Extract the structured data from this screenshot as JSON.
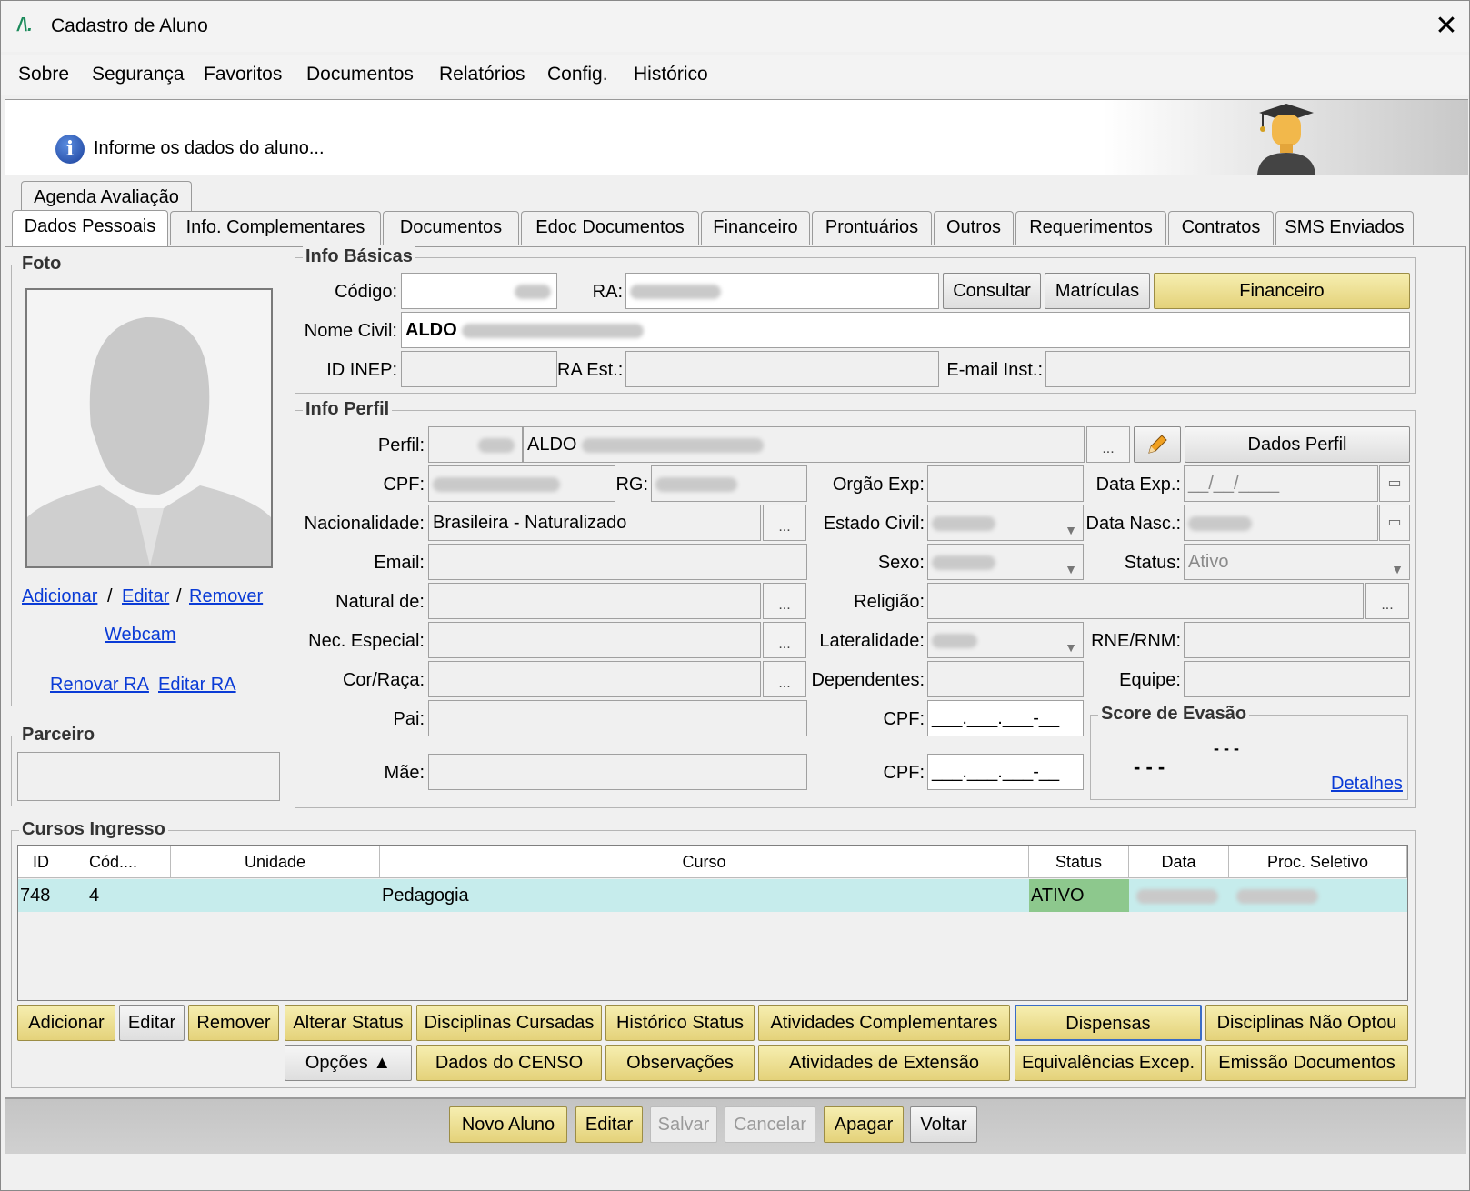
{
  "window": {
    "title": "Cadastro de Aluno",
    "logo": "/\\.",
    "close_icon": "✕"
  },
  "menu": [
    "Sobre",
    "Segurança",
    "Favoritos",
    "Documentos",
    "Relatórios",
    "Config.",
    "Histórico"
  ],
  "banner": {
    "text": "Informe os dados do aluno...",
    "info_glyph": "i"
  },
  "tabs_top": [
    "Agenda Avaliação"
  ],
  "tabs": [
    "Dados Pessoais",
    "Info. Complementares",
    "Documentos",
    "Edoc Documentos",
    "Financeiro",
    "Prontuários",
    "Outros",
    "Requerimentos",
    "Contratos",
    "SMS Enviados"
  ],
  "foto": {
    "title": "Foto",
    "add": "Adicionar",
    "sep": "/",
    "edit": "Editar",
    "remove": "Remover",
    "webcam": "Webcam",
    "renew_ra": "Renovar RA",
    "edit_ra": "Editar RA"
  },
  "parceiro": {
    "title": "Parceiro"
  },
  "info_basicas": {
    "title": "Info Básicas",
    "codigo_label": "Código:",
    "ra_label": "RA:",
    "consultar": "Consultar",
    "matriculas": "Matrículas",
    "financeiro": "Financeiro",
    "nome_label": "Nome Civil:",
    "nome_value": "ALDO",
    "inep_label": "ID INEP:",
    "ra_est_label": "RA Est.:",
    "email_inst_label": "E-mail Inst.:"
  },
  "info_perfil": {
    "title": "Info Perfil",
    "perfil_label": "Perfil:",
    "perfil_name": "ALDO",
    "dados_perfil": "Dados Perfil",
    "dots": "...",
    "cpf_label": "CPF:",
    "rg_label": "RG:",
    "orgao_label": "Orgão Exp:",
    "data_exp_label": "Data Exp.:",
    "data_exp_value": "__/__/____",
    "nacionalidade_label": "Nacionalidade:",
    "nacionalidade_value": "Brasileira - Naturalizado",
    "estado_civil_label": "Estado Civil:",
    "data_nasc_label": "Data Nasc.:",
    "email_label": "Email:",
    "sexo_label": "Sexo:",
    "status_label": "Status:",
    "status_value": "Ativo",
    "natural_label": "Natural de:",
    "religiao_label": "Religião:",
    "nec_label": "Nec. Especial:",
    "lateralidade_label": "Lateralidade:",
    "rne_label": "RNE/RNM:",
    "cor_label": "Cor/Raça:",
    "dependentes_label": "Dependentes:",
    "equipe_label": "Equipe:",
    "pai_label": "Pai:",
    "mae_label": "Mãe:",
    "cpf_mask": "___.___.___-__"
  },
  "score": {
    "title": "Score de Evasão",
    "value_top": "- - -",
    "value_main": "- - -",
    "details": "Detalhes"
  },
  "cursos": {
    "title": "Cursos Ingresso",
    "headers": [
      "ID",
      "Cód....",
      "Unidade",
      "Curso",
      "Status",
      "Data",
      "Proc. Seletivo"
    ],
    "row": {
      "id": "748",
      "cod": "4",
      "unidade": "",
      "curso": "Pedagogia",
      "status": "ATIVO"
    }
  },
  "course_buttons_row1": [
    "Adicionar",
    "Editar",
    "Remover",
    "Alterar Status",
    "Disciplinas Cursadas",
    "Histórico Status",
    "Atividades Complementares",
    "Dispensas",
    "Disciplinas Não Optou"
  ],
  "course_buttons_row2": [
    "Opções ▲",
    "Dados do CENSO",
    "Observações",
    "Atividades de Extensão",
    "Equivalências Excep.",
    "Emissão Documentos"
  ],
  "footer_buttons": [
    "Novo Aluno",
    "Editar",
    "Salvar",
    "Cancelar",
    "Apagar",
    "Voltar"
  ],
  "colors": {
    "gold": "#e4d27a",
    "status_active": "#8dc88d",
    "row_selected": "#c6ecec",
    "link": "#0a3bd6"
  }
}
